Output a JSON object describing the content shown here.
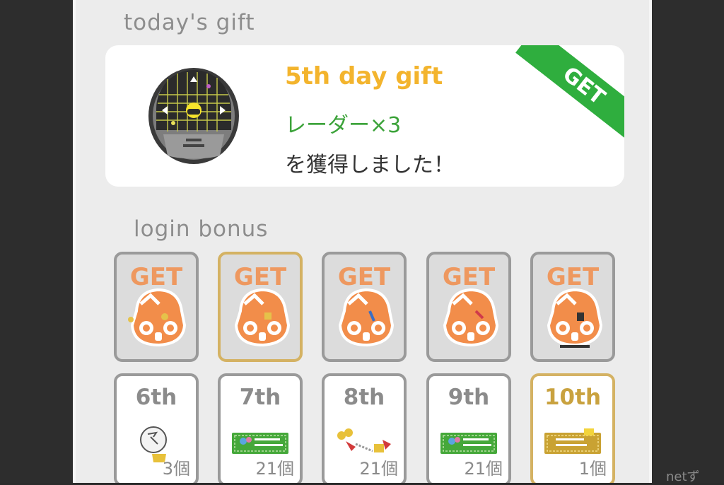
{
  "sidebar_peek": "netず",
  "today": {
    "section_title": "today's gift",
    "day_label": "5th day gift",
    "item_label": "レーダー×3",
    "message": "を獲得しました！",
    "ribbon": "GET"
  },
  "login_bonus": {
    "section_title": "login bonus",
    "claimed": [
      {
        "label": "GET",
        "item": "bells"
      },
      {
        "label": "GET",
        "item": "bag"
      },
      {
        "label": "GET",
        "item": "scarf"
      },
      {
        "label": "GET",
        "item": "figure"
      },
      {
        "label": "GET",
        "item": "lantern"
      }
    ],
    "upcoming": [
      {
        "day": "6th",
        "qty": "3個",
        "icon": "radar-bell-icon"
      },
      {
        "day": "7th",
        "qty": "21個",
        "icon": "friend-gacha-ticket-icon"
      },
      {
        "day": "8th",
        "qty": "21個",
        "icon": "ribbon-garland-icon"
      },
      {
        "day": "9th",
        "qty": "21個",
        "icon": "friend-gacha-ticket-icon"
      },
      {
        "day": "10th",
        "qty": "1個",
        "icon": "premium-gacha-ticket-icon"
      }
    ]
  },
  "colors": {
    "accent_orange": "#f3b42d",
    "accent_green": "#3ca33a",
    "ribbon_green": "#2fae3e",
    "gold_border": "#d4b263",
    "stamp_orange": "#f28d4a"
  }
}
